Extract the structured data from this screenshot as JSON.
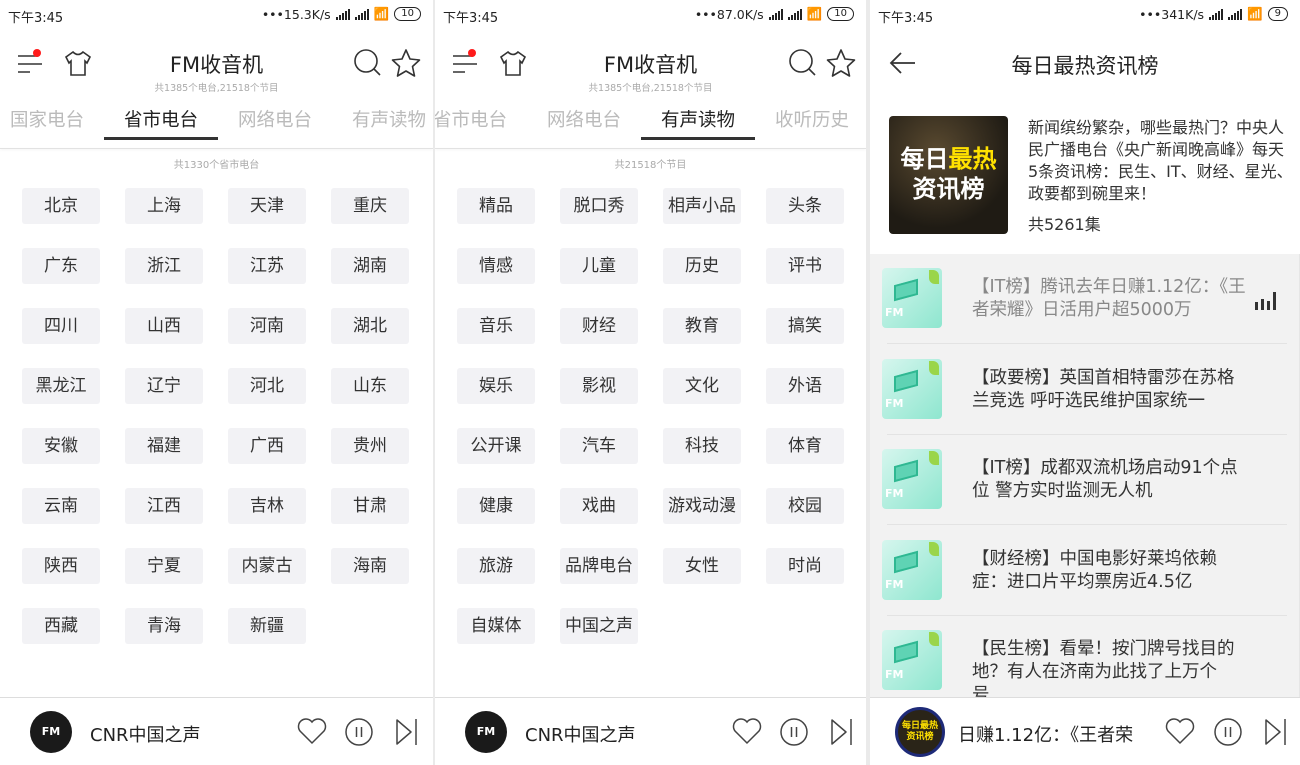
{
  "panels": [
    {
      "status": {
        "time": "下午3:45",
        "speed": "•••15.3K/s",
        "battery": "10"
      },
      "header": {
        "title": "FM收音机",
        "subtitle": "共1385个电台,21518个节目"
      },
      "tabs": [
        "国家电台",
        "省市电台",
        "网络电台",
        "有声读物"
      ],
      "active_tab": "省市电台",
      "caption": "共1330个省市电台",
      "items": [
        "北京",
        "上海",
        "天津",
        "重庆",
        "广东",
        "浙江",
        "江苏",
        "湖南",
        "四川",
        "山西",
        "河南",
        "湖北",
        "黑龙江",
        "辽宁",
        "河北",
        "山东",
        "安徽",
        "福建",
        "广西",
        "贵州",
        "云南",
        "江西",
        "吉林",
        "甘肃",
        "陕西",
        "宁夏",
        "内蒙古",
        "海南",
        "西藏",
        "青海",
        "新疆"
      ],
      "player": {
        "name": "CNR中国之声",
        "disc_label": "FM"
      }
    },
    {
      "status": {
        "time": "下午3:45",
        "speed": "•••87.0K/s",
        "battery": "10"
      },
      "header": {
        "title": "FM收音机",
        "subtitle": "共1385个电台,21518个节目"
      },
      "tabs": [
        "省市电台",
        "网络电台",
        "有声读物",
        "收听历史"
      ],
      "active_tab": "有声读物",
      "caption": "共21518个节目",
      "items": [
        "精品",
        "脱口秀",
        "相声小品",
        "头条",
        "情感",
        "儿童",
        "历史",
        "评书",
        "音乐",
        "财经",
        "教育",
        "搞笑",
        "娱乐",
        "影视",
        "文化",
        "外语",
        "公开课",
        "汽车",
        "科技",
        "体育",
        "健康",
        "戏曲",
        "游戏动漫",
        "校园",
        "旅游",
        "品牌电台",
        "女性",
        "时尚",
        "自媒体",
        "中国之声"
      ],
      "player": {
        "name": "CNR中国之声",
        "disc_label": "FM"
      }
    },
    {
      "status": {
        "time": "下午3:45",
        "speed": "•••341K/s",
        "battery": "9"
      },
      "header": {
        "title": "每日最热资讯榜"
      },
      "card": {
        "cover_line1_white": "每日",
        "cover_line1_yellow": "最热",
        "cover_line2": "资讯榜",
        "description": "新闻缤纷繁杂，哪些最热门？中央人民广播电台《央广新闻晚高峰》每天5条资讯榜：民生、IT、财经、星光、政要都到碗里来！",
        "count": "共5261集"
      },
      "episodes": [
        {
          "title": "【IT榜】腾讯去年日赚1.12亿：《王者荣耀》日活用户超5000万",
          "playing": true
        },
        {
          "title": "【政要榜】英国首相特雷莎在苏格兰竞选 呼吁选民维护国家统一",
          "playing": false
        },
        {
          "title": "【IT榜】成都双流机场启动91个点位 警方实时监测无人机",
          "playing": false
        },
        {
          "title": "【财经榜】中国电影好莱坞依赖症：进口片平均票房近4.5亿",
          "playing": false
        },
        {
          "title": "【民生榜】看晕！按门牌号找目的地？有人在济南为此找了上万个号……",
          "playing": false
        }
      ],
      "thumb_label": "FM",
      "player": {
        "name": "日赚1.12亿：《王者荣",
        "disc_label": "每日最热资讯榜"
      }
    }
  ],
  "colors": {
    "notification_dot": "#ff1a1a",
    "tab_active": "#222222",
    "chip_bg": "#f2f2f5",
    "disc_ring": "#1e2a78",
    "cover_highlight": "#ffe100"
  }
}
